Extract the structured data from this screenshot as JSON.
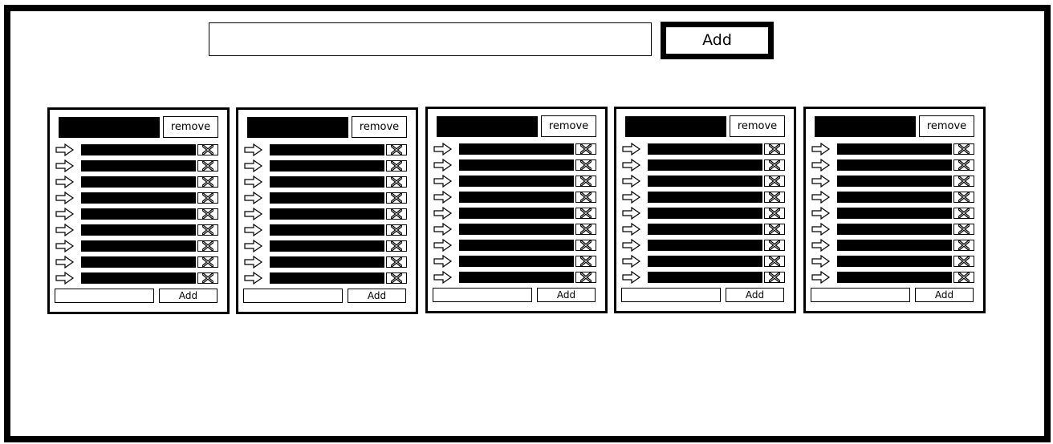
{
  "header": {
    "new_list_placeholder": "",
    "new_list_value": "",
    "add_label": "Add"
  },
  "list_template": {
    "remove_label": "remove",
    "add_label": "Add",
    "new_item_value": "",
    "drag_icon": "arrow-right-outline-icon",
    "delete_icon": "x-icon"
  },
  "lists": [
    {
      "title": "",
      "items": [
        "",
        "",
        "",
        "",
        "",
        "",
        "",
        "",
        ""
      ]
    },
    {
      "title": "",
      "items": [
        "",
        "",
        "",
        "",
        "",
        "",
        "",
        "",
        ""
      ]
    },
    {
      "title": "",
      "items": [
        "",
        "",
        "",
        "",
        "",
        "",
        "",
        "",
        ""
      ]
    },
    {
      "title": "",
      "items": [
        "",
        "",
        "",
        "",
        "",
        "",
        "",
        "",
        ""
      ]
    },
    {
      "title": "",
      "items": [
        "",
        "",
        "",
        "",
        "",
        "",
        "",
        "",
        ""
      ]
    }
  ],
  "colors": {
    "foreground": "#000000",
    "background": "#ffffff"
  }
}
